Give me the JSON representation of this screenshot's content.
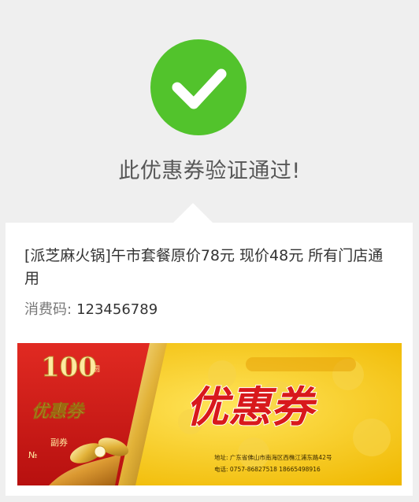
{
  "verify": {
    "status_text": "此优惠券验证通过!",
    "status_icon": "check-circle-icon"
  },
  "coupon": {
    "title": "[派芝麻火锅]午市套餐原价78元 现价48元 所有门店通用",
    "code_label": "消费码:",
    "code_value": "123456789"
  },
  "ticket_image": {
    "amount": "100",
    "unit": "圆",
    "stub_title": "优惠券",
    "stub_label": "副券",
    "no_label": "№",
    "main_title": "优惠券",
    "address": "地址: 广东省佛山市南海区西樵江浦东路42号",
    "phone": "电话: 0757-86827518   18665498916"
  },
  "colors": {
    "success": "#52c32c",
    "background": "#efefef",
    "ticket_red": "#d21a1a",
    "ticket_yellow": "#f3c60c"
  }
}
